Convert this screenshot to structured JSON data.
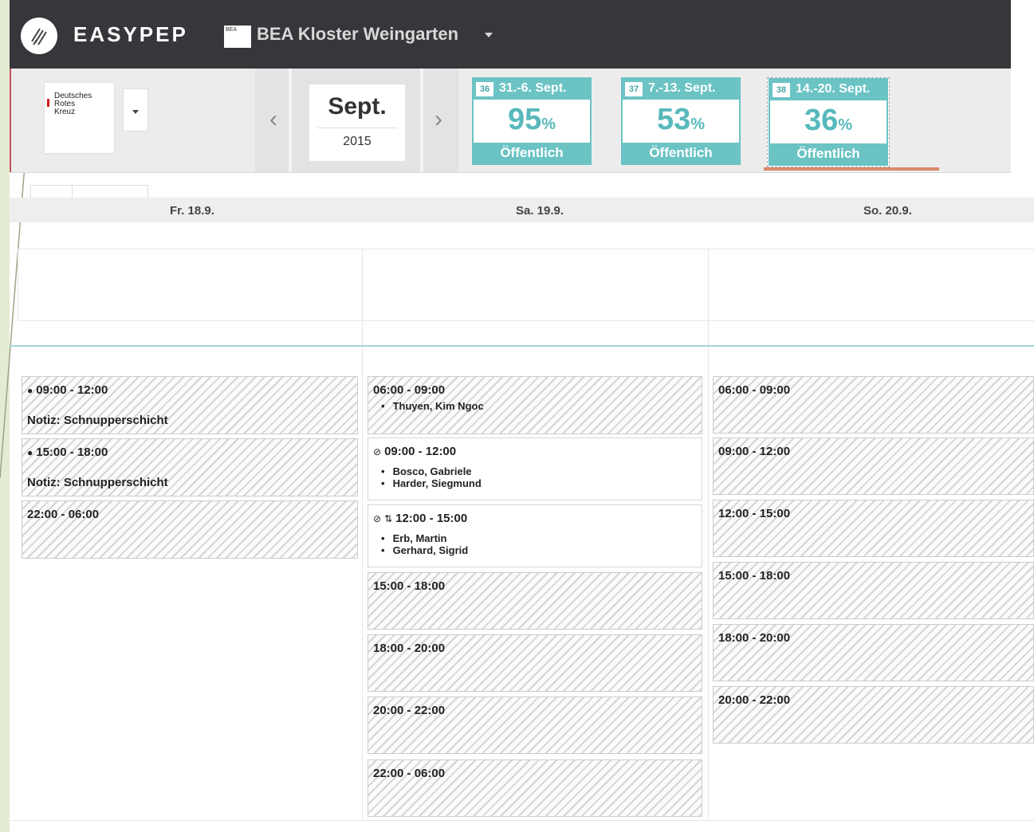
{
  "app": {
    "logo_text": "EASYPEP",
    "org_name": "BEA Kloster Weingarten",
    "org_icon_text": "BEA"
  },
  "client": {
    "name_lines": [
      "Deutsches",
      "Rotes",
      "Kreuz"
    ],
    "brand_color": "#d51a1a"
  },
  "month": {
    "prev_label": "‹",
    "name": "Sept.",
    "year": "2015",
    "next_label": "›"
  },
  "weeks": [
    {
      "num": "36",
      "range": "31.-6. Sept.",
      "percent": "95",
      "unit": "%",
      "status": "Öffentlich",
      "active": false
    },
    {
      "num": "37",
      "range": "7.-13. Sept.",
      "percent": "53",
      "unit": "%",
      "status": "Öffentlich",
      "active": false
    },
    {
      "num": "38",
      "range": "14.-20. Sept.",
      "percent": "36",
      "unit": "%",
      "status": "Öffentlich",
      "active": true
    }
  ],
  "days": [
    {
      "label": "Fr. 18.9."
    },
    {
      "label": "Sa. 19.9."
    },
    {
      "label": "So. 20.9."
    }
  ],
  "shifts": {
    "fr": [
      {
        "time": "09:00 - 12:00",
        "icon": "comment-icon",
        "note": "Notiz: Schnupperschicht"
      },
      {
        "time": "15:00 - 18:00",
        "icon": "comment-icon",
        "note": "Notiz: Schnupperschicht"
      },
      {
        "time": "22:00 - 06:00"
      }
    ],
    "sa": [
      {
        "time": "06:00 - 09:00",
        "names": [
          "Thuyen, Kim Ngoc"
        ]
      },
      {
        "time": "09:00 - 12:00",
        "icon": "check-circle-icon",
        "names": [
          "Bosco, Gabriele",
          "Harder, Siegmund"
        ]
      },
      {
        "time": "12:00 - 15:00",
        "icon": "check-circle-icon",
        "icon2": "swap-icon",
        "names": [
          "Erb, Martin",
          "Gerhard, Sigrid"
        ]
      },
      {
        "time": "15:00 - 18:00"
      },
      {
        "time": "18:00 - 20:00"
      },
      {
        "time": "20:00 - 22:00"
      },
      {
        "time": "22:00 - 06:00"
      }
    ],
    "so": [
      {
        "time": "06:00 - 09:00"
      },
      {
        "time": "09:00 - 12:00"
      },
      {
        "time": "12:00 - 15:00"
      },
      {
        "time": "15:00 - 18:00"
      },
      {
        "time": "18:00 - 20:00"
      },
      {
        "time": "20:00 - 22:00"
      }
    ]
  },
  "colors": {
    "accent": "#6bc3c4",
    "header_bg": "#36363b",
    "active_week_underline": "#d98a6b"
  }
}
